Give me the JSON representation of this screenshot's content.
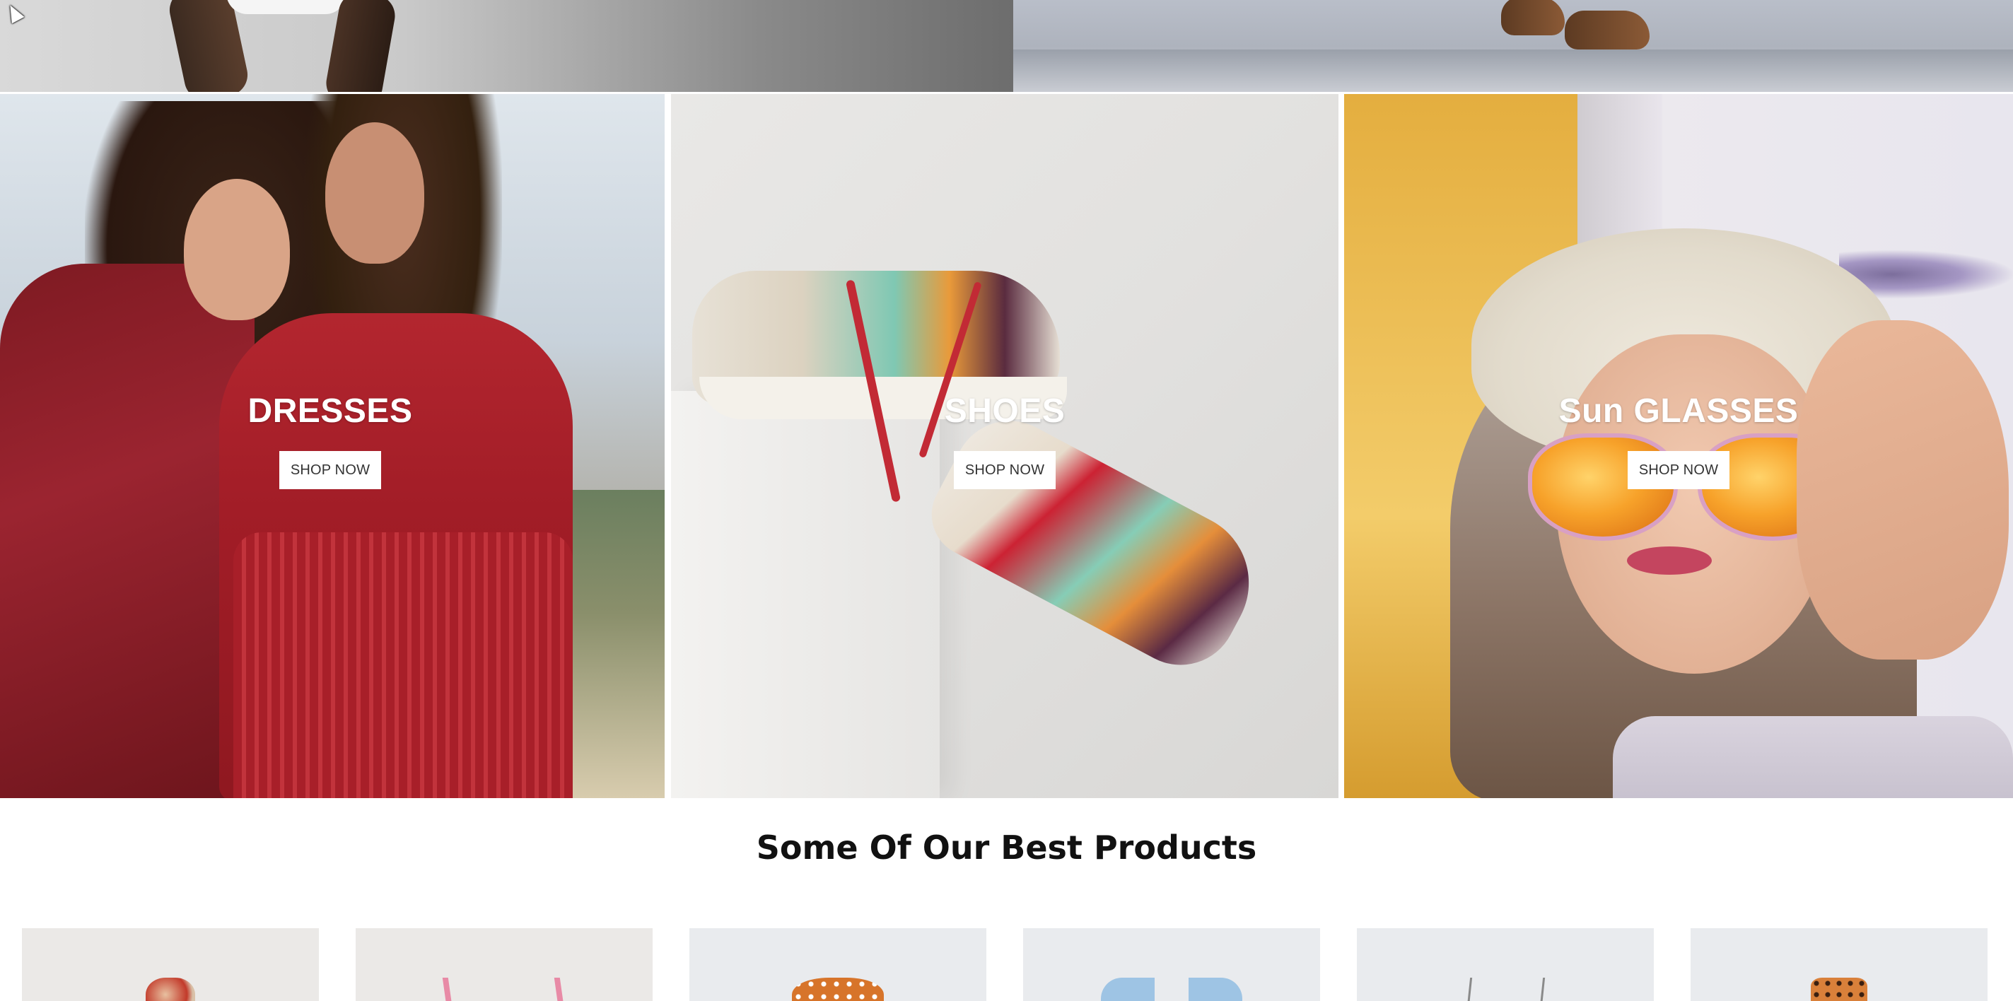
{
  "categories": [
    {
      "title": "DRESSES",
      "button_label": "SHOP NOW"
    },
    {
      "title": "SHOES",
      "button_label": "SHOP NOW"
    },
    {
      "title": "Sun GLASSES",
      "button_label": "SHOP NOW"
    }
  ],
  "best_products": {
    "heading": "Some Of Our Best Products",
    "items": [
      {
        "thumb_icon": "red-bow-accessory-image"
      },
      {
        "thumb_icon": "pink-strap-top-image"
      },
      {
        "thumb_icon": "orange-polka-dot-dress-image"
      },
      {
        "thumb_icon": "light-blue-denim-top-image"
      },
      {
        "thumb_icon": "grey-strap-garment-image"
      },
      {
        "thumb_icon": "orange-print-dress-image"
      }
    ]
  },
  "colors": {
    "banner_text": "#ffffff",
    "button_bg": "#ffffff",
    "button_text": "#333333",
    "heading_text": "#111111"
  }
}
